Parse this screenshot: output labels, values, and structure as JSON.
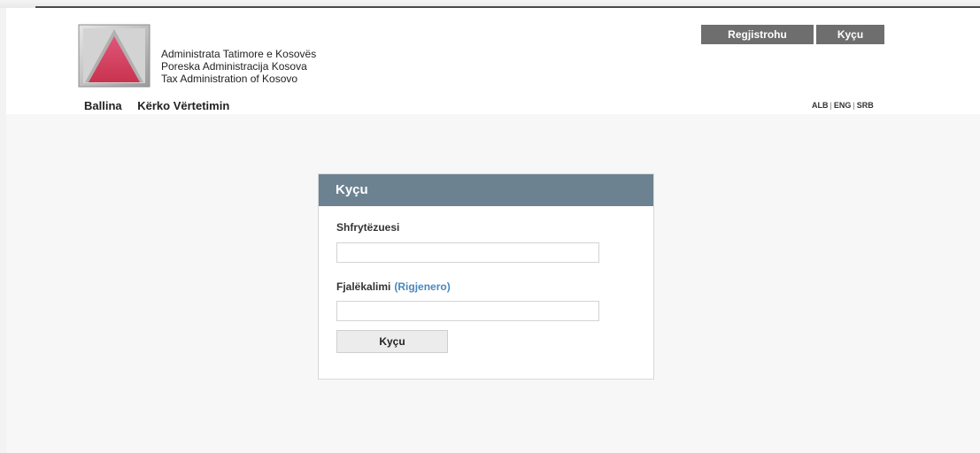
{
  "org": {
    "name_alb": "Administrata Tatimore e Kosovës",
    "name_srb": "Poreska Administracija Kosova",
    "name_eng": "Tax Administration of Kosovo",
    "logo_icon": "atk-triangle-logo",
    "logo_color": "#d6415f"
  },
  "header": {
    "register_label": "Regjistrohu",
    "login_label": "Kyçu",
    "button_color": "#6e6e6e"
  },
  "nav": {
    "items": [
      {
        "label": "Ballina"
      },
      {
        "label": "Kërko Vërtetimin"
      }
    ]
  },
  "languages": {
    "alb": "ALB",
    "sep": "|",
    "eng": "ENG",
    "srb": "SRB"
  },
  "login": {
    "title": "Kyçu",
    "header_color": "#6d8291",
    "username_label": "Shfrytëzuesi",
    "username_value": "",
    "password_label": "Fjalëkalimi",
    "regenerate_link": "(Rigjenero)",
    "password_value": "",
    "submit_label": "Kyçu",
    "link_color": "#4a86bf"
  }
}
